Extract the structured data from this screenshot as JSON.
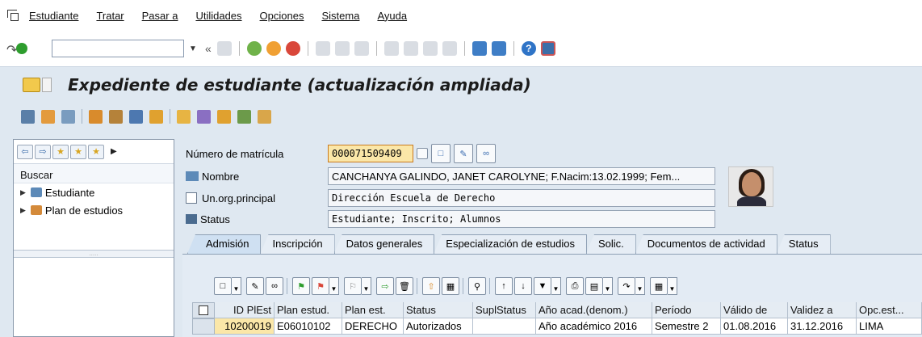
{
  "menu": {
    "items": [
      "Estudiante",
      "Tratar",
      "Pasar a",
      "Utilidades",
      "Opciones",
      "Sistema",
      "Ayuda"
    ]
  },
  "toolbar": {
    "command_value": ""
  },
  "title": "Expediente de estudiante (actualización ampliada)",
  "left_panel": {
    "search_label": "Buscar",
    "items": [
      "Estudiante",
      "Plan de estudios"
    ]
  },
  "header": {
    "matricula": {
      "label": "Número de matrícula",
      "value": "000071509409"
    },
    "nombre": {
      "label": "Nombre",
      "value": "CANCHANYA GALINDO, JANET CAROLYNE; F.Nacim:13.02.1999; Fem..."
    },
    "unorg": {
      "label": "Un.org.principal",
      "value": "Dirección Escuela de Derecho"
    },
    "status": {
      "label": "Status",
      "value": "Estudiante; Inscrito; Alumnos"
    }
  },
  "tabs": [
    "Admisión",
    "Inscripción",
    "Datos generales",
    "Especialización de estudios",
    "Solic.",
    "Documentos de actividad",
    "Status"
  ],
  "grid": {
    "columns": [
      "ID PlEst",
      "Plan estud.",
      "Plan est.",
      "Status",
      "SuplStatus",
      "Año acad.(denom.)",
      "Período",
      "Válido de",
      "Validez a",
      "Opc.est..."
    ],
    "rows": [
      [
        "10200019",
        "E06010102",
        "DERECHO",
        "Autorizados",
        "",
        "Año académico 2016",
        "Semestre 2",
        "01.08.2016",
        "31.12.2016",
        "LIMA"
      ]
    ]
  },
  "colors": {
    "background": "#dfe8f1",
    "key_field": "#fbe7a8",
    "title_text": "#1b1b1b"
  }
}
